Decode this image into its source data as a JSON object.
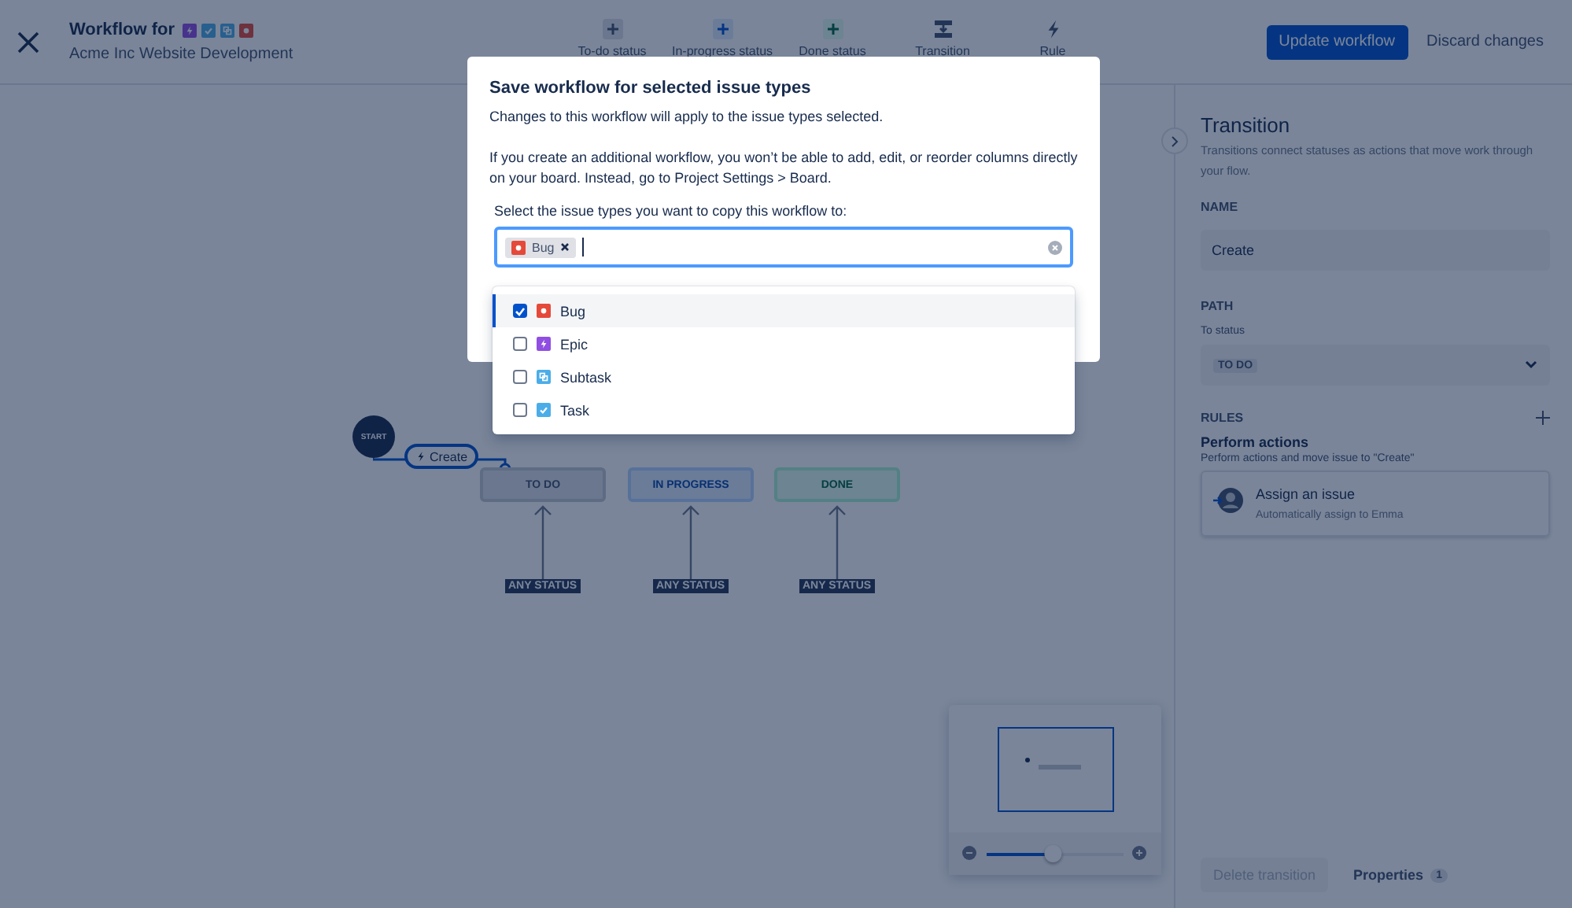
{
  "header": {
    "title": "Workflow for",
    "issue_types": [
      {
        "kind": "epic"
      },
      {
        "kind": "task"
      },
      {
        "kind": "subtask"
      },
      {
        "kind": "bug"
      }
    ],
    "subtitle": "Acme Inc Website Development"
  },
  "toolbar": [
    {
      "kind": "todo",
      "label": "To-do status"
    },
    {
      "kind": "progress",
      "label": "In-progress status"
    },
    {
      "kind": "done",
      "label": "Done status"
    },
    {
      "kind": "transition",
      "label": "Transition"
    },
    {
      "kind": "rule",
      "label": "Rule"
    }
  ],
  "actions": {
    "primary": "Update workflow",
    "secondary": "Discard changes"
  },
  "diagram": {
    "start": "START",
    "transition": "Create",
    "statuses": [
      {
        "kind": "todo",
        "label": "TO DO"
      },
      {
        "kind": "progress",
        "label": "IN PROGRESS"
      },
      {
        "kind": "done",
        "label": "DONE"
      }
    ],
    "any_status": [
      "ANY STATUS",
      "ANY STATUS",
      "ANY STATUS"
    ]
  },
  "minimap": {
    "level": 0.48
  },
  "panel": {
    "title": "Transition",
    "description": "Transitions connect statuses as actions that move work through your flow.",
    "name_label": "NAME",
    "name_value": "Create",
    "path_label": "PATH",
    "to_status_label": "To status",
    "to_status_value": "TO DO",
    "rules_label": "RULES",
    "rules_title": "Perform actions",
    "rules_description": "Perform actions and move issue to \"Create\"",
    "rule": {
      "title": "Assign an issue",
      "description": "Automatically assign to Emma"
    },
    "delete": "Delete transition",
    "properties": "Properties",
    "properties_count": "1"
  },
  "modal": {
    "title": "Save workflow for selected issue types",
    "paragraphs": [
      "Changes to this workflow will apply to the issue types selected.",
      "If you create an additional workflow, you won’t be able to add, edit, or reorder columns directly on your board. Instead, go to Project Settings > Board."
    ],
    "select_label": "Select the issue types you want to copy this workflow to:",
    "tags": [
      {
        "kind": "bug",
        "label": "Bug"
      }
    ],
    "options": [
      {
        "kind": "bug",
        "label": "Bug",
        "checked": true,
        "selected": true
      },
      {
        "kind": "epic",
        "label": "Epic",
        "checked": false,
        "selected": false
      },
      {
        "kind": "subtask",
        "label": "Subtask",
        "checked": false,
        "selected": false
      },
      {
        "kind": "task",
        "label": "Task",
        "checked": false,
        "selected": false
      }
    ]
  }
}
